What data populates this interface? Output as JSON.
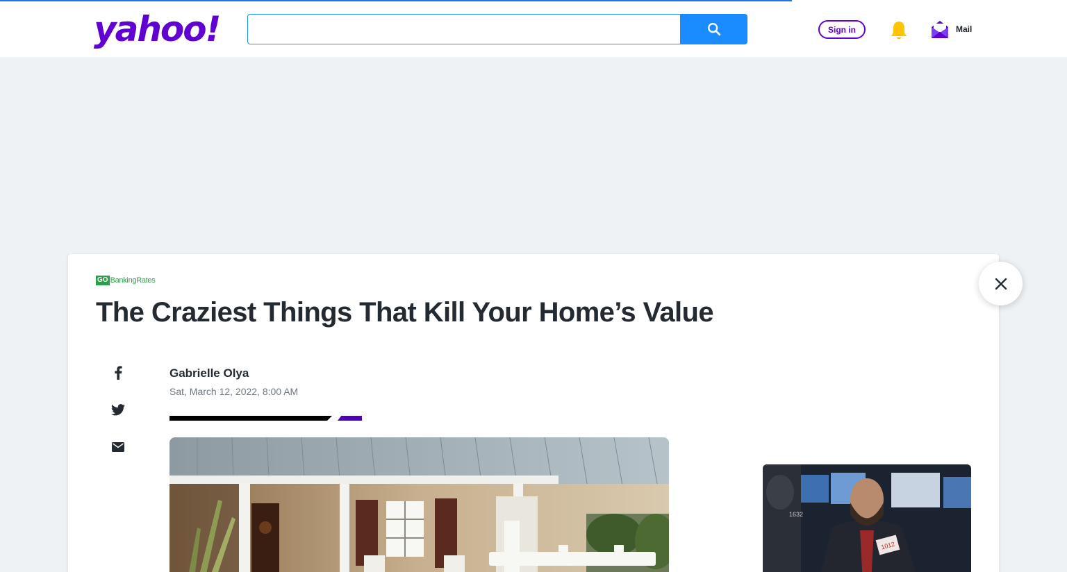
{
  "header": {
    "logo_text": "yahoo!",
    "search": {
      "value": "",
      "placeholder": ""
    },
    "search_button_icon": "search-icon",
    "signin_label": "Sign in",
    "notifications_icon": "bell-icon",
    "mail_label": "Mail",
    "mail_icon": "mail-icon"
  },
  "colors": {
    "brand_purple": "#6001d2",
    "search_blue": "#1a8cff",
    "bell_yellow": "#ffc400",
    "source_green": "#2f9e49",
    "rule_purple": "#4f03b6"
  },
  "article": {
    "source": {
      "go": "GO",
      "name": "BankingRates"
    },
    "title": "The Craziest Things That Kill Your Home’s Value",
    "author": "Gabrielle Olya",
    "date": "Sat, March 12, 2022, 8:00 AM",
    "share_icons": [
      "facebook-icon",
      "twitter-icon",
      "email-icon"
    ]
  },
  "overlay": {
    "close_icon": "close-icon"
  }
}
